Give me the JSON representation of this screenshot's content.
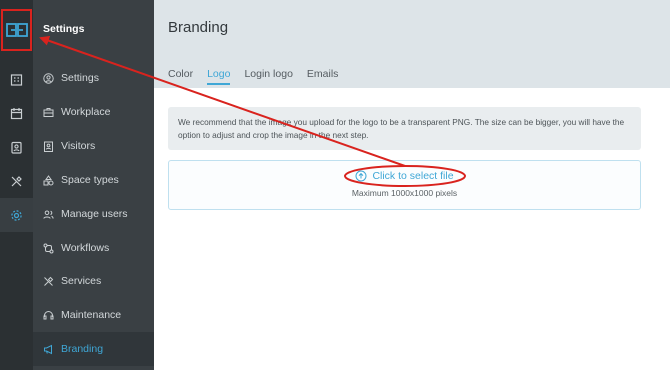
{
  "app": {
    "logo_icon": "gg-logo-icon"
  },
  "rail": {
    "items": [
      {
        "icon": "building-icon"
      },
      {
        "icon": "calendar-icon"
      },
      {
        "icon": "badge-icon"
      },
      {
        "icon": "tools-icon"
      },
      {
        "icon": "gear-icon",
        "active": true
      }
    ]
  },
  "nav": {
    "title": "Settings",
    "items": [
      {
        "label": "Settings",
        "icon": "user-circle-icon"
      },
      {
        "label": "Workplace",
        "icon": "briefcase-icon"
      },
      {
        "label": "Visitors",
        "icon": "id-badge-icon"
      },
      {
        "label": "Space types",
        "icon": "shapes-icon"
      },
      {
        "label": "Manage users",
        "icon": "users-icon"
      },
      {
        "label": "Workflows",
        "icon": "workflow-icon"
      },
      {
        "label": "Services",
        "icon": "tools-icon"
      },
      {
        "label": "Maintenance",
        "icon": "headset-icon"
      },
      {
        "label": "Branding",
        "icon": "megaphone-icon",
        "active": true
      }
    ]
  },
  "main": {
    "title": "Branding",
    "tabs": [
      {
        "label": "Color"
      },
      {
        "label": "Logo",
        "active": true
      },
      {
        "label": "Login logo"
      },
      {
        "label": "Emails"
      }
    ],
    "info_text": "We recommend that the image you upload for the logo to be a transparent PNG. The size can be bigger, you will have the option to adjust and crop the image in the next step.",
    "upload": {
      "link_label": "Click to select file",
      "hint": "Maximum 1000x1000 pixels",
      "icon": "upload-cloud-icon"
    }
  },
  "colors": {
    "accent": "#3fa7d6",
    "annotation": "#d9231e",
    "sidebar_dark": "#2b3033",
    "sidebar": "#3a4044",
    "header_bg": "#dde4e8"
  }
}
